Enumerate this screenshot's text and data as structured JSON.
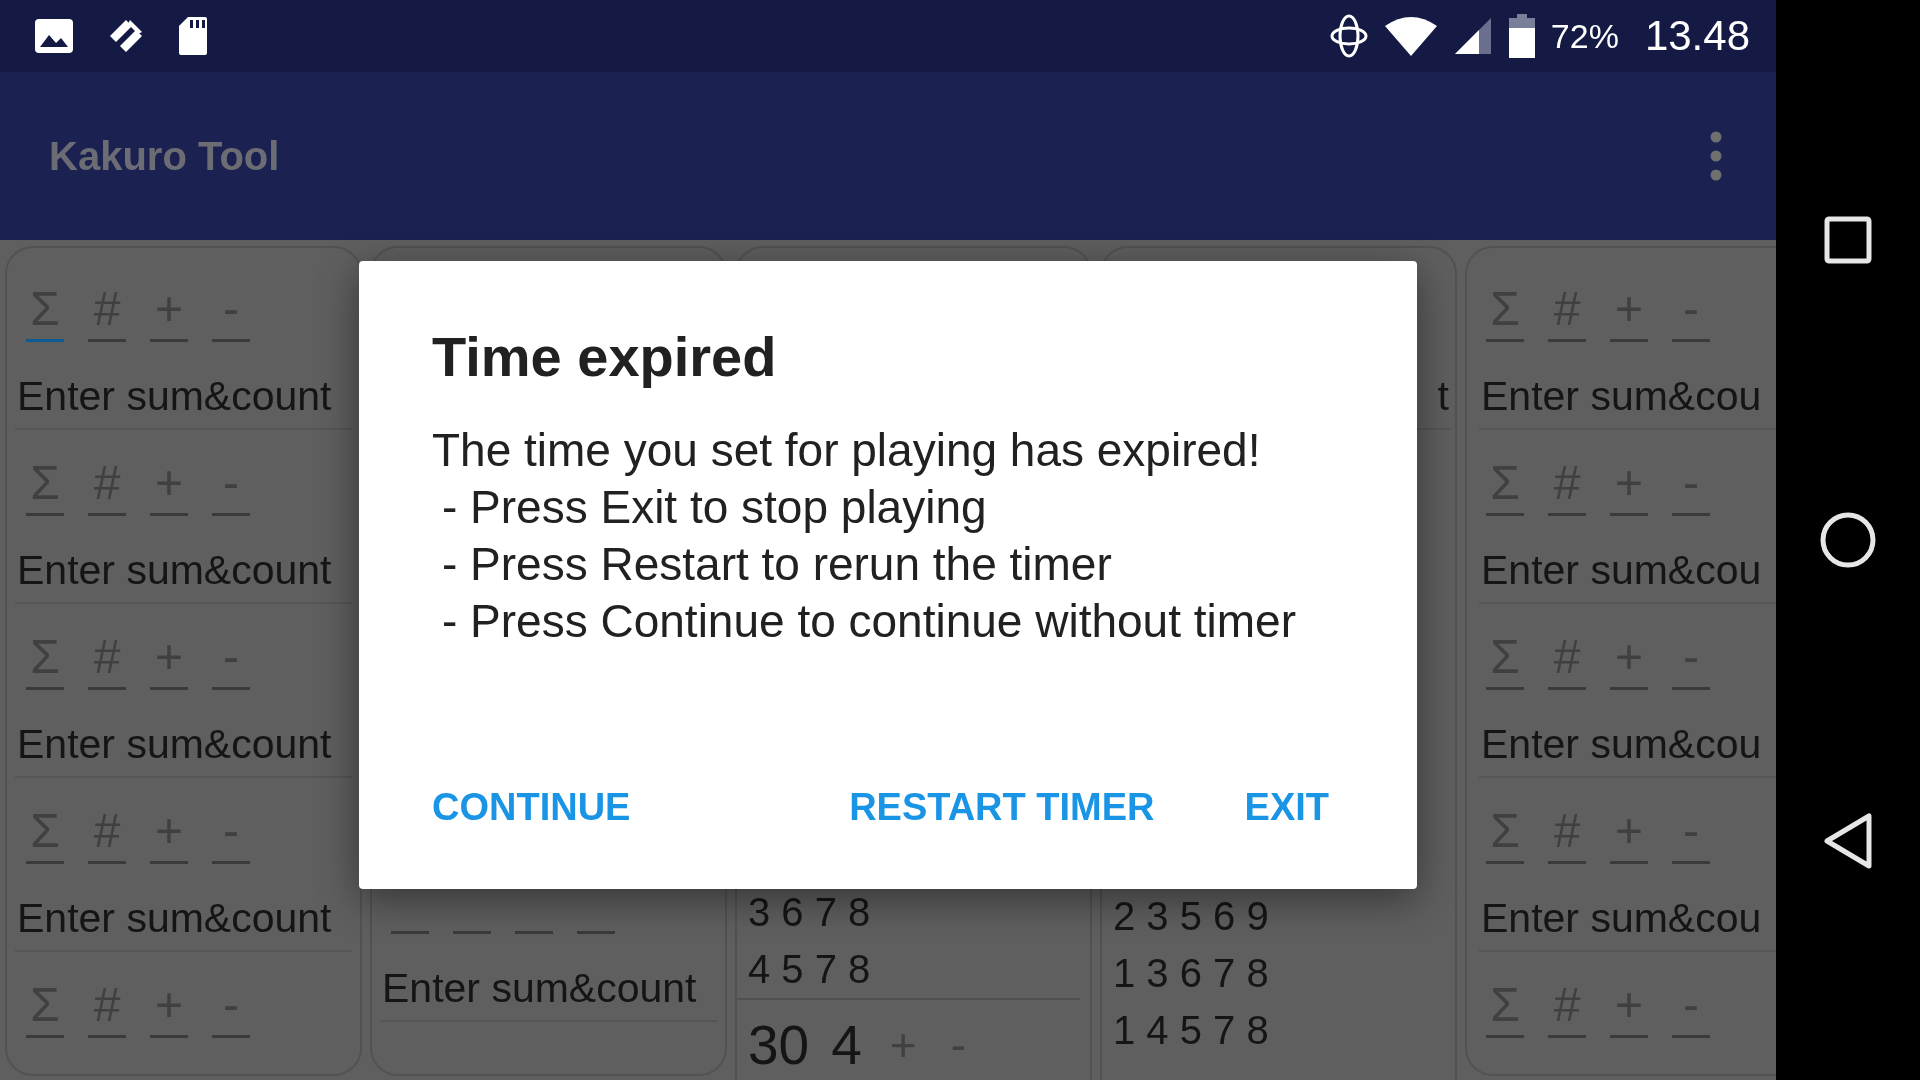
{
  "status_bar": {
    "battery": "72%",
    "time": "13.48"
  },
  "app_bar": {
    "title": "Kakuro Tool"
  },
  "columns": [
    {
      "items": [
        {
          "kind": "toolbar",
          "tabs": [
            {
              "label": "Σ",
              "selected": true
            },
            {
              "label": "#",
              "selected": false
            },
            {
              "label": "+",
              "selected": false
            },
            {
              "label": "-",
              "selected": false
            }
          ]
        },
        {
          "kind": "field",
          "placeholder": "Enter sum&count"
        },
        {
          "kind": "toolbar",
          "tabs": [
            {
              "label": "Σ",
              "selected": false
            },
            {
              "label": "#",
              "selected": false
            },
            {
              "label": "+",
              "selected": false
            },
            {
              "label": "-",
              "selected": false
            }
          ]
        },
        {
          "kind": "field",
          "placeholder": "Enter sum&count"
        },
        {
          "kind": "toolbar",
          "tabs": [
            {
              "label": "Σ",
              "selected": false
            },
            {
              "label": "#",
              "selected": false
            },
            {
              "label": "+",
              "selected": false
            },
            {
              "label": "-",
              "selected": false
            }
          ]
        },
        {
          "kind": "field",
          "placeholder": "Enter sum&count"
        },
        {
          "kind": "toolbar",
          "tabs": [
            {
              "label": "Σ",
              "selected": false
            },
            {
              "label": "#",
              "selected": false
            },
            {
              "label": "+",
              "selected": false
            },
            {
              "label": "-",
              "selected": false
            }
          ]
        },
        {
          "kind": "field",
          "placeholder": "Enter sum&count"
        },
        {
          "kind": "toolbar",
          "tabs": [
            {
              "label": "Σ",
              "selected": false
            },
            {
              "label": "#",
              "selected": false
            },
            {
              "label": "+",
              "selected": false
            },
            {
              "label": "-",
              "selected": false
            }
          ]
        }
      ]
    },
    {
      "items": [
        {
          "kind": "toolbar",
          "tabs": [
            {
              "selected": false
            },
            {
              "selected": false
            },
            {
              "selected": false
            },
            {
              "selected": false
            }
          ]
        },
        {
          "kind": "field",
          "placeholder": "Enter sum&count"
        }
      ]
    },
    {
      "items": [
        {
          "kind": "combination",
          "text": "3 6 7 8"
        },
        {
          "kind": "combination",
          "text": "4 5 7 8"
        },
        {
          "kind": "sum_row",
          "sum": "30",
          "count": "4",
          "buttons": [
            "+",
            "-"
          ]
        }
      ]
    },
    {
      "items": [
        {
          "kind": "field",
          "placeholder": "t"
        },
        {
          "kind": "combination",
          "text": "2 3 5 6 9"
        },
        {
          "kind": "combination",
          "text": "1 3 6 7 8"
        },
        {
          "kind": "combination",
          "text": "1 4 5 7 8"
        }
      ]
    },
    {
      "items": [
        {
          "kind": "toolbar",
          "tabs": [
            {
              "label": "Σ",
              "selected": false
            },
            {
              "label": "#",
              "selected": false
            },
            {
              "label": "+",
              "selected": false
            },
            {
              "label": "-",
              "selected": false
            }
          ]
        },
        {
          "kind": "field",
          "placeholder": "Enter sum&cou"
        },
        {
          "kind": "toolbar",
          "tabs": [
            {
              "label": "Σ",
              "selected": false
            },
            {
              "label": "#",
              "selected": false
            },
            {
              "label": "+",
              "selected": false
            },
            {
              "label": "-",
              "selected": false
            }
          ]
        },
        {
          "kind": "field",
          "placeholder": "Enter sum&cou"
        },
        {
          "kind": "toolbar",
          "tabs": [
            {
              "label": "Σ",
              "selected": false
            },
            {
              "label": "#",
              "selected": false
            },
            {
              "label": "+",
              "selected": false
            },
            {
              "label": "-",
              "selected": false
            }
          ]
        },
        {
          "kind": "field",
          "placeholder": "Enter sum&cou"
        },
        {
          "kind": "toolbar",
          "tabs": [
            {
              "label": "Σ",
              "selected": false
            },
            {
              "label": "#",
              "selected": false
            },
            {
              "label": "+",
              "selected": false
            },
            {
              "label": "-",
              "selected": false
            }
          ]
        },
        {
          "kind": "field",
          "placeholder": "Enter sum&cou"
        },
        {
          "kind": "toolbar",
          "tabs": [
            {
              "label": "Σ",
              "selected": false
            },
            {
              "label": "#",
              "selected": false
            },
            {
              "label": "+",
              "selected": false
            },
            {
              "label": "-",
              "selected": false
            }
          ]
        }
      ]
    }
  ],
  "dialog": {
    "title": "Time expired",
    "message": "The time you set for playing has expired!",
    "bullets": [
      "- Press Exit to stop playing",
      "- Press Restart to rerun the timer",
      "- Press Continue to continue without timer"
    ],
    "buttons": [
      {
        "label": "CONTINUE"
      },
      {
        "label": "RESTART TIMER"
      },
      {
        "label": "EXIT"
      }
    ]
  }
}
